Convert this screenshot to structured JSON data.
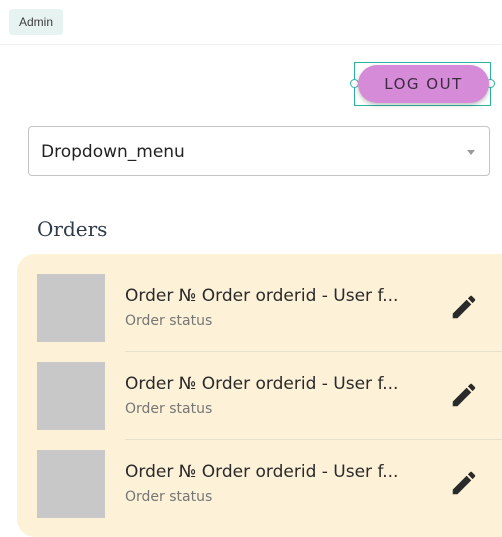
{
  "header": {
    "badge": "Admin"
  },
  "toolbar": {
    "logout_label": "LOG OUT"
  },
  "dropdown": {
    "selected": "Dropdown_menu"
  },
  "orders": {
    "title": "Orders",
    "items": [
      {
        "title": "Order № Order orderid - User f...",
        "status": "Order status"
      },
      {
        "title": "Order № Order orderid - User f...",
        "status": "Order status"
      },
      {
        "title": "Order № Order orderid - User f...",
        "status": "Order status"
      }
    ]
  },
  "colors": {
    "accent": "#d68bd8",
    "card_bg": "#fdf1d8",
    "selection": "#2bb3a0"
  },
  "icons": {
    "edit": "pencil-icon",
    "caret": "caret-down-icon"
  }
}
